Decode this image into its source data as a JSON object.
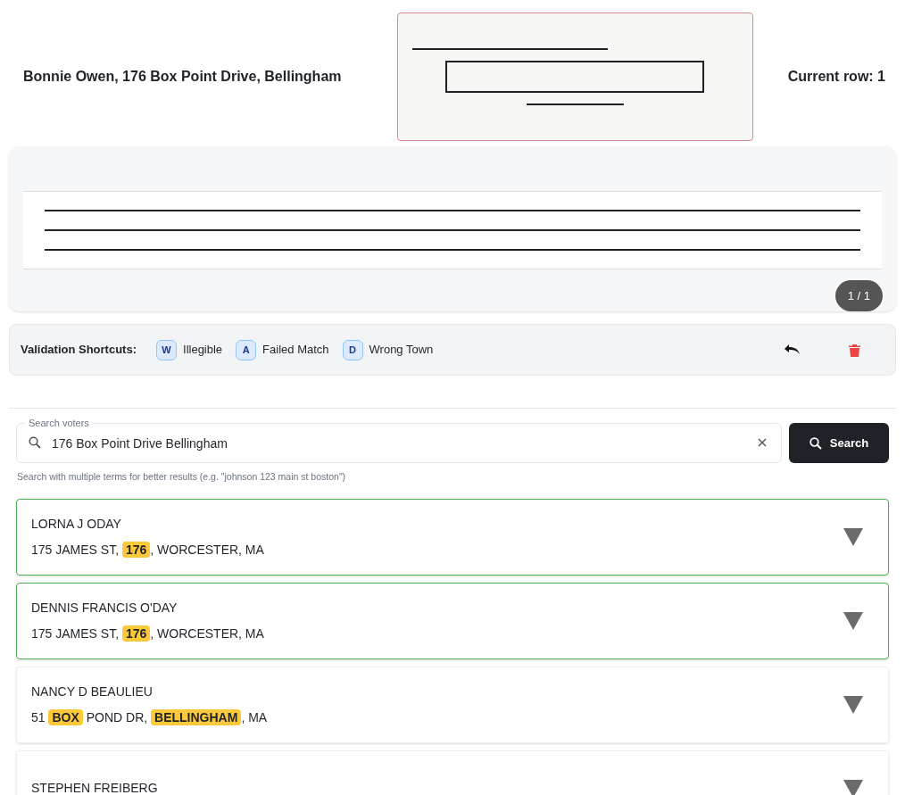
{
  "header": {
    "record": "Bonnie Owen, 176 Box Point Drive, Bellingham",
    "current_row": "Current row: 1"
  },
  "viewer": {
    "page_indicator": "1 / 1"
  },
  "shortcuts": {
    "label": "Validation Shortcuts:",
    "items": [
      {
        "key": "W",
        "label": "Illegible"
      },
      {
        "key": "A",
        "label": "Failed Match"
      },
      {
        "key": "D",
        "label": "Wrong Town"
      }
    ]
  },
  "search": {
    "label": "Search voters",
    "value": "176 Box Point Drive Bellingham",
    "button": "Search",
    "hint": "Search with multiple terms for better results (e.g. \"johnson 123 main st boston\")"
  },
  "results": [
    {
      "name": "LORNA J ODAY",
      "address": "175 JAMES ST, **176**, WORCESTER, MA",
      "matched": true
    },
    {
      "name": "DENNIS FRANCIS O'DAY",
      "address": "175 JAMES ST, **176**, WORCESTER, MA",
      "matched": true
    },
    {
      "name": "NANCY D BEAULIEU",
      "address": "51 **BOX** POND DR, **BELLINGHAM**, MA",
      "matched": false
    },
    {
      "name": "STEPHEN FREIBERG",
      "matched": false
    }
  ]
}
